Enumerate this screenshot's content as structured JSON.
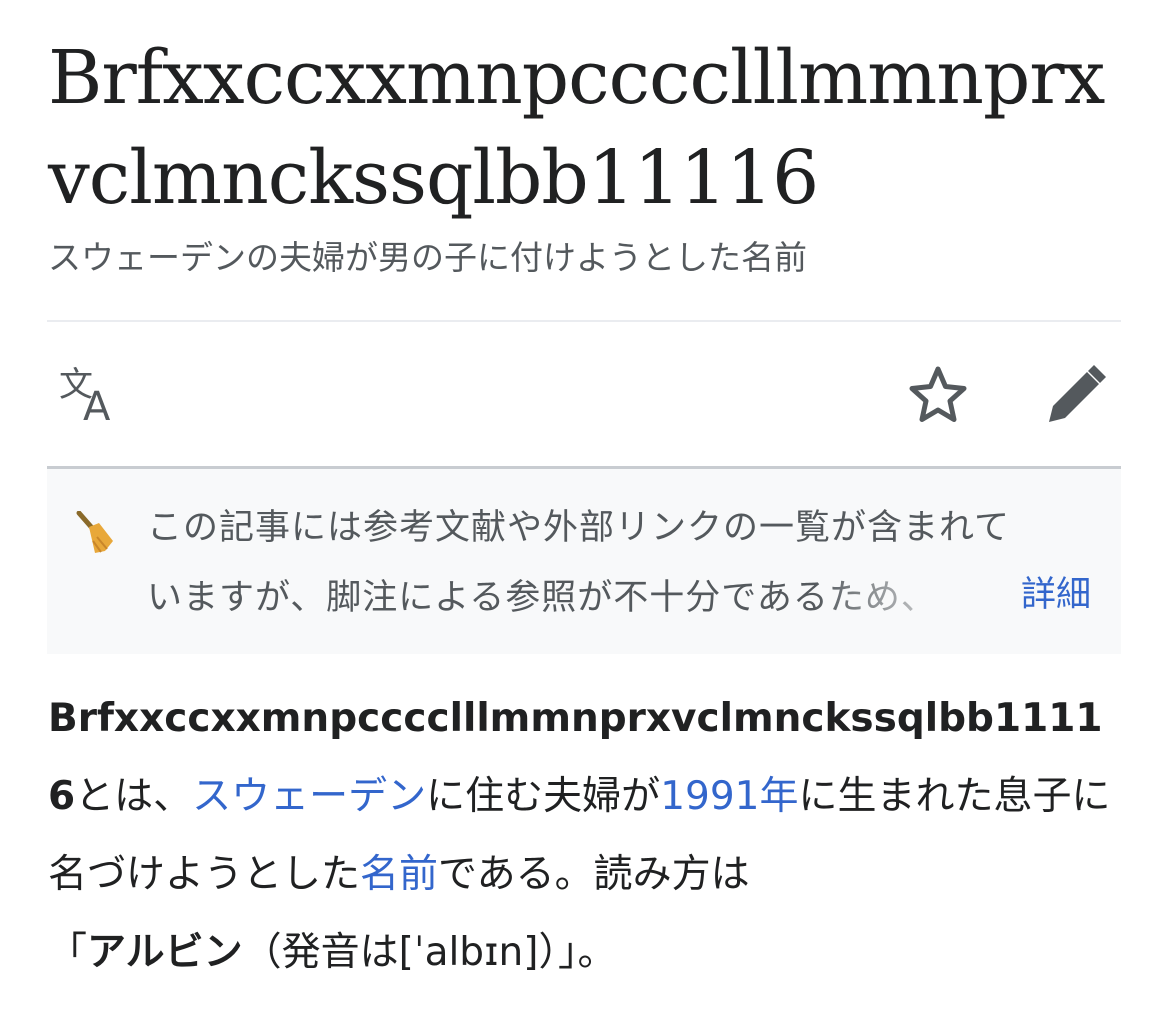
{
  "article": {
    "title": "Brfxxccxxmnpcccclllmmnprxvclmnckssqlbb11116",
    "description": "スウェーデンの夫婦が男の子に付けようとした名前"
  },
  "page_actions": {
    "language_icon": "translate-icon",
    "watch_icon": "star-icon",
    "edit_icon": "pencil-icon"
  },
  "notice": {
    "icon": "broom-icon",
    "line1": "この記事には参考文献や外部リンクの一覧が含まれて",
    "line2": "いますが、脚注による参照が不十分であるため、",
    "more_link": "詳細"
  },
  "lead": {
    "bold_term": "Brfxxccxxmnpcccclllmmnprxvclmnckssqlbb11116",
    "text1": "とは、",
    "link_sweden": "スウェーデン",
    "text2": "に住む夫婦が",
    "link_year": "1991年",
    "text3": "に生まれた息子に名づけようとした",
    "link_name": "名前",
    "text4": "である。読み方は",
    "quote_open": "「",
    "reading": "アルビン",
    "pronunciation": "（発音は[ˈalbɪn]）",
    "quote_close": "」。"
  },
  "colors": {
    "link": "#3366cc",
    "text": "#202122",
    "muted": "#54595d",
    "notice_bg": "#f8f9fa",
    "icon": "#54595d"
  }
}
